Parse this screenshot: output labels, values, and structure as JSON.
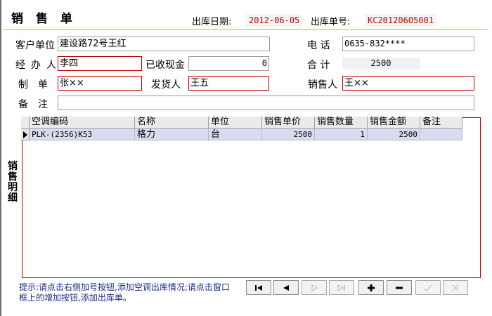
{
  "header": {
    "title": "销 售 单",
    "date_label": "出库日期:",
    "date_value": "2012-06-05",
    "number_label": "出库单号:",
    "number_value": "KC20120605001"
  },
  "form": {
    "customer": {
      "label": "客户单位",
      "value": "建设路72号王红"
    },
    "phone": {
      "label": "电 话",
      "value": "0635-832****"
    },
    "handler": {
      "label": "经办人",
      "value": "李四"
    },
    "cash": {
      "label": "已收现金",
      "value": "0"
    },
    "total": {
      "label": "合 计",
      "value": "2500"
    },
    "maker": {
      "label": "制单",
      "value": "张××"
    },
    "shipper": {
      "label": "发货人",
      "value": "王五"
    },
    "seller": {
      "label": "销售人",
      "value": "王××"
    },
    "remark": {
      "label": "备注",
      "value": ""
    }
  },
  "detail": {
    "section_label": "销售明细",
    "columns": [
      "空调编码",
      "名称",
      "单位",
      "销售单价",
      "销售数量",
      "销售金额",
      "备注"
    ],
    "rows": [
      {
        "code": "PLK-(2356)K53",
        "name": "格力",
        "unit": "台",
        "price": "2500",
        "qty": "1",
        "amount": "2500",
        "note": ""
      }
    ]
  },
  "hint": "提示:请点击右侧加号按钮,添加空调出库情况;请点击窗口框上的增加按钮,添加出库单。",
  "nav_buttons": [
    {
      "icon": "first-record-icon",
      "enabled": true
    },
    {
      "icon": "previous-record-icon",
      "enabled": true
    },
    {
      "icon": "next-record-icon",
      "enabled": false
    },
    {
      "icon": "last-record-icon",
      "enabled": false
    },
    {
      "icon": "add-record-icon",
      "enabled": true
    },
    {
      "icon": "delete-record-icon",
      "enabled": true
    },
    {
      "icon": "save-check-icon",
      "enabled": false
    },
    {
      "icon": "cancel-x-icon",
      "enabled": false
    }
  ],
  "colors": {
    "required_border": "#c00000",
    "header_value": "#cc0000",
    "hint_text": "#1a2a8a",
    "selected_row": "#d8dcee"
  }
}
